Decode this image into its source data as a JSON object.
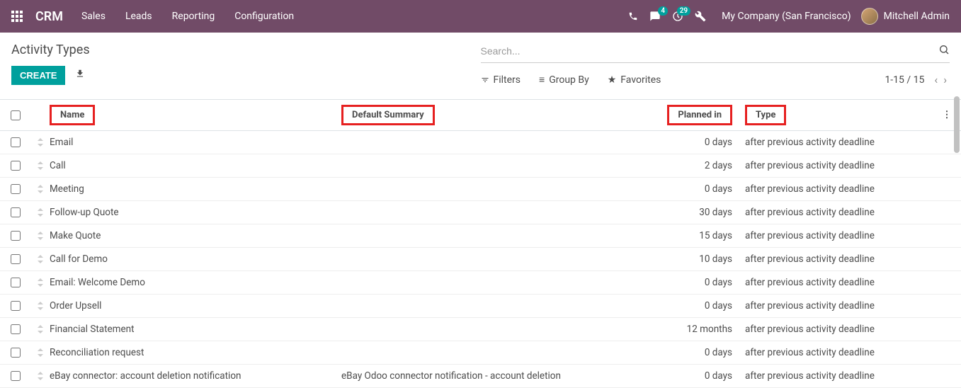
{
  "topbar": {
    "brand": "CRM",
    "nav": [
      "Sales",
      "Leads",
      "Reporting",
      "Configuration"
    ],
    "messages_badge": "4",
    "activities_badge": "29",
    "company": "My Company (San Francisco)",
    "user": "Mitchell Admin"
  },
  "page": {
    "title": "Activity Types",
    "create_label": "CREATE",
    "search_placeholder": "Search...",
    "filters_label": "Filters",
    "groupby_label": "Group By",
    "favorites_label": "Favorites",
    "pager": "1-15 / 15"
  },
  "columns": {
    "name": "Name",
    "summary": "Default Summary",
    "planned": "Planned in",
    "type": "Type"
  },
  "rows": [
    {
      "name": "Email",
      "summary": "",
      "planned": "0 days",
      "type": "after previous activity deadline"
    },
    {
      "name": "Call",
      "summary": "",
      "planned": "2 days",
      "type": "after previous activity deadline"
    },
    {
      "name": "Meeting",
      "summary": "",
      "planned": "0 days",
      "type": "after previous activity deadline"
    },
    {
      "name": "Follow-up Quote",
      "summary": "",
      "planned": "30 days",
      "type": "after previous activity deadline"
    },
    {
      "name": "Make Quote",
      "summary": "",
      "planned": "15 days",
      "type": "after previous activity deadline"
    },
    {
      "name": "Call for Demo",
      "summary": "",
      "planned": "10 days",
      "type": "after previous activity deadline"
    },
    {
      "name": "Email: Welcome Demo",
      "summary": "",
      "planned": "0 days",
      "type": "after previous activity deadline"
    },
    {
      "name": "Order Upsell",
      "summary": "",
      "planned": "0 days",
      "type": "after previous activity deadline"
    },
    {
      "name": "Financial Statement",
      "summary": "",
      "planned": "12 months",
      "type": "after previous activity deadline"
    },
    {
      "name": "Reconciliation request",
      "summary": "",
      "planned": "0 days",
      "type": "after previous activity deadline"
    },
    {
      "name": "eBay connector: account deletion notification",
      "summary": "eBay Odoo connector notification - account deletion",
      "planned": "0 days",
      "type": "after previous activity deadline"
    }
  ]
}
